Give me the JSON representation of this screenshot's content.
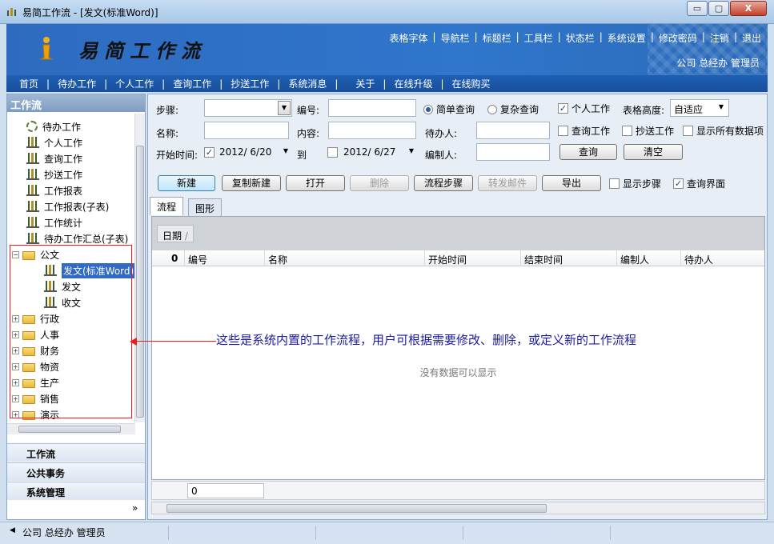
{
  "window": {
    "title": "易简工作流 - [发文(标准Word)]",
    "buttons": [
      "▭",
      "▢",
      "X"
    ]
  },
  "banner": {
    "logo_text": "易简工作流",
    "links": [
      "表格字体",
      "导航栏",
      "标题栏",
      "工具栏",
      "状态栏",
      "系统设置",
      "修改密码",
      "注销",
      "退出"
    ],
    "user_info": "公司 总经办 管理员"
  },
  "menu": [
    "首页",
    "待办工作",
    "个人工作",
    "查询工作",
    "抄送工作",
    "系统消息",
    "关于",
    "在线升级",
    "在线购买"
  ],
  "left_panel": {
    "title": "工作流",
    "tree": [
      {
        "label": "待办工作",
        "icon": "gear-icon"
      },
      {
        "label": "个人工作",
        "icon": "report-icon"
      },
      {
        "label": "查询工作",
        "icon": "report-icon"
      },
      {
        "label": "抄送工作",
        "icon": "report-icon"
      },
      {
        "label": "工作报表",
        "icon": "report-icon"
      },
      {
        "label": "工作报表(子表)",
        "icon": "report-icon"
      },
      {
        "label": "工作统计",
        "icon": "report-icon"
      },
      {
        "label": "待办工作汇总(子表)",
        "icon": "report-icon"
      },
      {
        "label": "公文",
        "icon": "folder-icon",
        "expanded": true
      },
      {
        "label": "发文(标准Word)",
        "icon": "report-icon",
        "selected": true
      },
      {
        "label": "发文",
        "icon": "report-icon"
      },
      {
        "label": "收文",
        "icon": "report-icon"
      },
      {
        "label": "行政",
        "icon": "folder-icon"
      },
      {
        "label": "人事",
        "icon": "folder-icon"
      },
      {
        "label": "财务",
        "icon": "folder-icon"
      },
      {
        "label": "物资",
        "icon": "folder-icon"
      },
      {
        "label": "生产",
        "icon": "folder-icon"
      },
      {
        "label": "销售",
        "icon": "folder-icon"
      },
      {
        "label": "演示",
        "icon": "folder-icon"
      }
    ],
    "nav_groups": [
      "工作流",
      "公共事务",
      "系统管理"
    ],
    "more_glyph": "»"
  },
  "search": {
    "step_label": "步骤:",
    "step_value": "",
    "number_label": "编号:",
    "number_value": "",
    "simple_query": "简单查询",
    "complex_query": "复杂查询",
    "personal_work": "个人工作",
    "table_height_label": "表格高度:",
    "table_height_value": "自适应",
    "name_label": "名称:",
    "content_label": "内容:",
    "assignee_label": "待办人:",
    "query_work": "查询工作",
    "cc_work": "抄送工作",
    "show_all": "显示所有数据项",
    "start_time_label": "开始时间:",
    "start_date": "2012/ 6/20",
    "to_label": "到",
    "end_date": "2012/ 6/27",
    "editor_label": "编制人:",
    "query_button": "查询",
    "clear_button": "清空"
  },
  "toolbar": {
    "new": "新建",
    "copy_new": "复制新建",
    "open": "打开",
    "delete": "删除",
    "flow_steps": "流程步骤",
    "forward_mail": "转发邮件",
    "export": "导出",
    "show_steps": "显示步骤",
    "query_ui": "查询界面"
  },
  "tabs": [
    "流程",
    "图形"
  ],
  "grid": {
    "group_chip": "日期",
    "columns": [
      "编号",
      "名称",
      "开始时间",
      "结束时间",
      "编制人",
      "待办人"
    ],
    "attach_col": "0",
    "empty_text": "没有数据可以显示",
    "footer_count": "0"
  },
  "annotation": "这些是系统内置的工作流程，用户可根据需要修改、删除，或定义新的工作流程",
  "status": {
    "user": "公司 总经办 管理员"
  },
  "colors": {
    "banner": "#2f76cc",
    "menubar": "#1f5fb3",
    "annotation": "#1a1aa0",
    "highlight_box": "#e02020",
    "selection": "#3169c6"
  }
}
